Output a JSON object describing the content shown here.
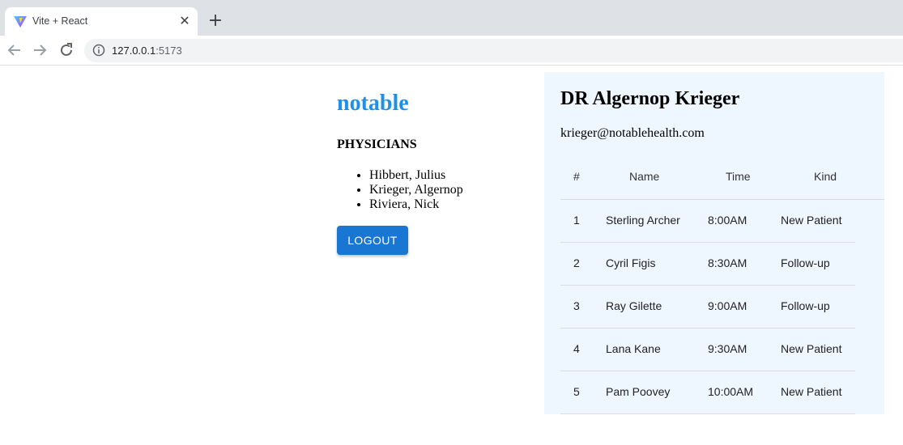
{
  "browser": {
    "tab_title": "Vite + React",
    "url_host": "127.0.0.1",
    "url_port": ":5173"
  },
  "app": {
    "logo": "notable",
    "physicians_heading": "PHYSICIANS",
    "physicians": [
      "Hibbert, Julius",
      "Krieger, Algernop",
      "Riviera, Nick"
    ],
    "logout_label": "LOGOUT"
  },
  "doctor": {
    "name": "DR Algernop Krieger",
    "email": "krieger@notablehealth.com"
  },
  "appointments": {
    "columns": [
      "#",
      "Name",
      "Time",
      "Kind"
    ],
    "rows": [
      {
        "num": "1",
        "name": "Sterling Archer",
        "time": "8:00AM",
        "kind": "New Patient"
      },
      {
        "num": "2",
        "name": "Cyril Figis",
        "time": "8:30AM",
        "kind": "Follow-up"
      },
      {
        "num": "3",
        "name": "Ray Gilette",
        "time": "9:00AM",
        "kind": "Follow-up"
      },
      {
        "num": "4",
        "name": "Lana Kane",
        "time": "9:30AM",
        "kind": "New Patient"
      },
      {
        "num": "5",
        "name": "Pam Poovey",
        "time": "10:00AM",
        "kind": "New Patient"
      }
    ]
  },
  "colors": {
    "brand": "#1e90e8",
    "button": "#1976d2",
    "panel_bg": "#eef6ff"
  }
}
